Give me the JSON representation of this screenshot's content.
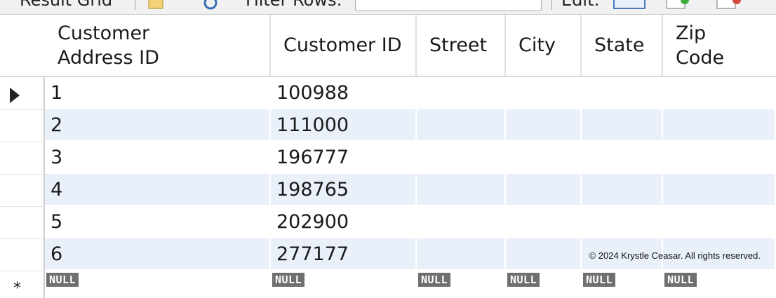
{
  "toolbar": {
    "result_grid_label": "Result Grid",
    "filter_rows_label": "Filter Rows:",
    "filter_value": "",
    "edit_label": "Edit:"
  },
  "grid": {
    "columns": [
      "Customer\nAddress ID",
      "Customer ID",
      "Street",
      "City",
      "State",
      "Zip\nCode"
    ],
    "rows": [
      [
        "1",
        "100988",
        "",
        "",
        "",
        ""
      ],
      [
        "2",
        "111000",
        "",
        "",
        "",
        ""
      ],
      [
        "3",
        "196777",
        "",
        "",
        "",
        ""
      ],
      [
        "4",
        "198765",
        "",
        "",
        "",
        ""
      ],
      [
        "5",
        "202900",
        "",
        "",
        "",
        ""
      ],
      [
        "6",
        "277177",
        "",
        "",
        "",
        ""
      ]
    ],
    "new_row_values": [
      "NULL",
      "NULL",
      "NULL",
      "NULL",
      "NULL",
      "NULL"
    ],
    "current_row_marker": "▶",
    "new_row_marker": "*"
  },
  "copyright": "© 2024 Krystle Ceasar. All rights reserved.",
  "colors": {
    "alt_row": "#e9f0fa",
    "null_badge": "#6f6f6f"
  }
}
